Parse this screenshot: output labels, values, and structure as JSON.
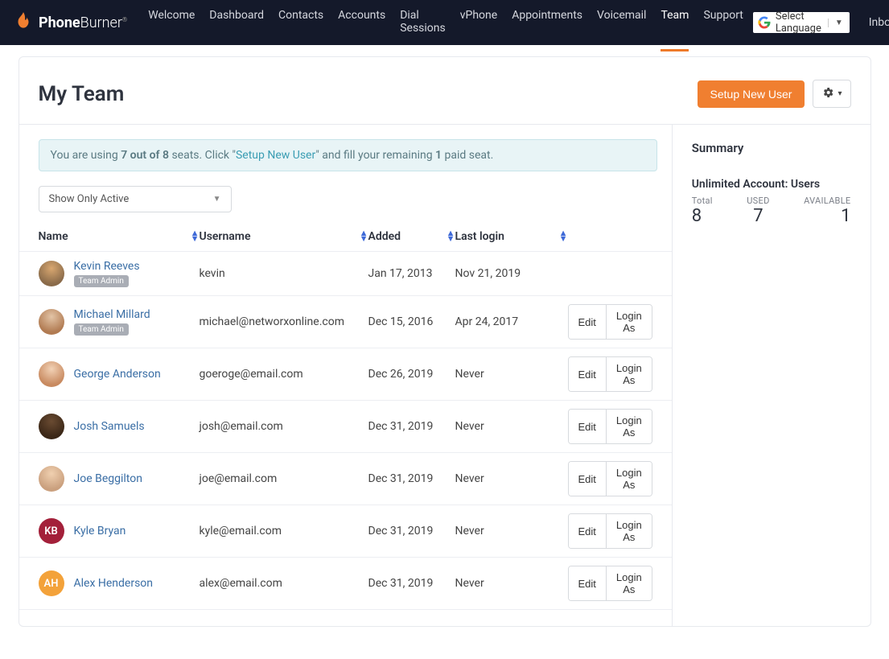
{
  "brand": {
    "bold": "Phone",
    "light": "Burner",
    "tm": "®"
  },
  "nav": {
    "items": [
      {
        "label": "Welcome",
        "active": false
      },
      {
        "label": "Dashboard",
        "active": false
      },
      {
        "label": "Contacts",
        "active": false
      },
      {
        "label": "Accounts",
        "active": false
      },
      {
        "label": "Dial Sessions",
        "active": false
      },
      {
        "label": "vPhone",
        "active": false
      },
      {
        "label": "Appointments",
        "active": false
      },
      {
        "label": "Voicemail",
        "active": false
      },
      {
        "label": "Team",
        "active": true
      },
      {
        "label": "Support",
        "active": false
      }
    ],
    "language_label": "Select Language",
    "inbox_label": "Inbox"
  },
  "page": {
    "title": "My Team",
    "setup_btn": "Setup New User"
  },
  "alert": {
    "prefix": "You are using ",
    "count": "7 out of 8",
    "seats": " seats. Click ",
    "quote_open": "\"",
    "link": "Setup New User",
    "quote_close": "\"",
    "middle": " and fill your remaining ",
    "remaining": "1",
    "suffix": " paid seat."
  },
  "filter": {
    "selected": "Show Only Active"
  },
  "table": {
    "headers": {
      "name": "Name",
      "username": "Username",
      "added": "Added",
      "last_login": "Last login"
    },
    "actions": {
      "edit": "Edit",
      "login_as": "Login As"
    },
    "badge": "Team Admin",
    "rows": [
      {
        "name": "Kevin Reeves",
        "username": "kevin",
        "added": "Jan 17, 2013",
        "login": "Nov 21, 2019",
        "admin": true,
        "actions": false,
        "avatar_class": "av1"
      },
      {
        "name": "Michael Millard",
        "username": "michael@networxonline.com",
        "added": "Dec 15, 2016",
        "login": "Apr 24, 2017",
        "admin": true,
        "actions": true,
        "avatar_class": "av2"
      },
      {
        "name": "George Anderson",
        "username": "goeroge@email.com",
        "added": "Dec 26, 2019",
        "login": "Never",
        "admin": false,
        "actions": true,
        "avatar_class": "av3"
      },
      {
        "name": "Josh Samuels",
        "username": "josh@email.com",
        "added": "Dec 31, 2019",
        "login": "Never",
        "admin": false,
        "actions": true,
        "avatar_class": "av4"
      },
      {
        "name": "Joe Beggilton",
        "username": "joe@email.com",
        "added": "Dec 31, 2019",
        "login": "Never",
        "admin": false,
        "actions": true,
        "avatar_class": "av5"
      },
      {
        "name": "Kyle Bryan",
        "username": "kyle@email.com",
        "added": "Dec 31, 2019",
        "login": "Never",
        "admin": false,
        "actions": true,
        "avatar_class": "av-kb",
        "initials": "KB"
      },
      {
        "name": "Alex Henderson",
        "username": "alex@email.com",
        "added": "Dec 31, 2019",
        "login": "Never",
        "admin": false,
        "actions": true,
        "avatar_class": "av-ah",
        "initials": "AH"
      }
    ]
  },
  "summary": {
    "title": "Summary",
    "account_label": "Unlimited Account: Users",
    "total_label": "Total",
    "used_label": "USED",
    "available_label": "AVAILABLE",
    "total": "8",
    "used": "7",
    "available": "1"
  }
}
